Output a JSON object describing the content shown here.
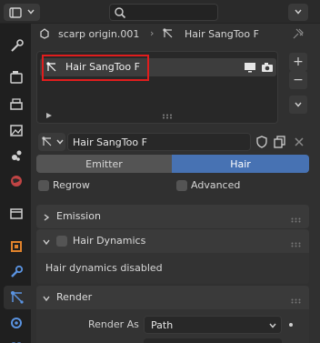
{
  "breadcrumb": {
    "object": "scarp origin.001",
    "particle_system": "Hair SangToo F"
  },
  "particle_list": {
    "items": [
      {
        "label": "Hair SangToo F"
      }
    ]
  },
  "particle_settings": {
    "name": "Hair SangToo F"
  },
  "type_toggle": {
    "emitter_label": "Emitter",
    "hair_label": "Hair",
    "selected": "Hair"
  },
  "options": {
    "regrow_label": "Regrow",
    "advanced_label": "Advanced"
  },
  "panels": {
    "emission_title": "Emission",
    "hair_dynamics_title": "Hair Dynamics",
    "hair_dynamics_message": "Hair dynamics disabled",
    "render_title": "Render"
  },
  "render": {
    "render_as_label": "Render As",
    "render_as_value": "Path"
  },
  "colors": {
    "accent": "#4772b3",
    "highlight": "#e01d1d",
    "background": "#303030"
  }
}
